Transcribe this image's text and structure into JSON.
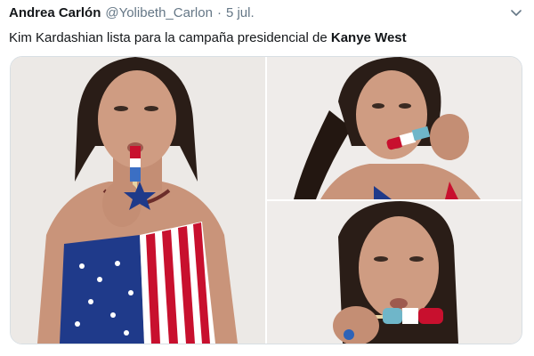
{
  "tweet": {
    "display_name": "Andrea Carlón",
    "handle": "@Yolibeth_Carlon",
    "separator": "·",
    "date": "5 jul.",
    "text_prefix": "Kim Kardashian lista para la campaña presidencial de ",
    "text_bold": "Kanye West",
    "menu_icon": "chevron-down-icon"
  },
  "media": {
    "count": 3,
    "photos": [
      {
        "position": "left-large",
        "depicts": "woman in flag swimsuit with popsicle"
      },
      {
        "position": "top-right",
        "depicts": "woman biting popsicle, ponytail"
      },
      {
        "position": "bottom-right",
        "depicts": "woman close-up with popsicle"
      }
    ]
  },
  "colors": {
    "text": "#14171a",
    "secondary": "#657786",
    "border": "#d8dee3",
    "flag_red": "#c8102e",
    "flag_blue": "#1f3a8a"
  }
}
